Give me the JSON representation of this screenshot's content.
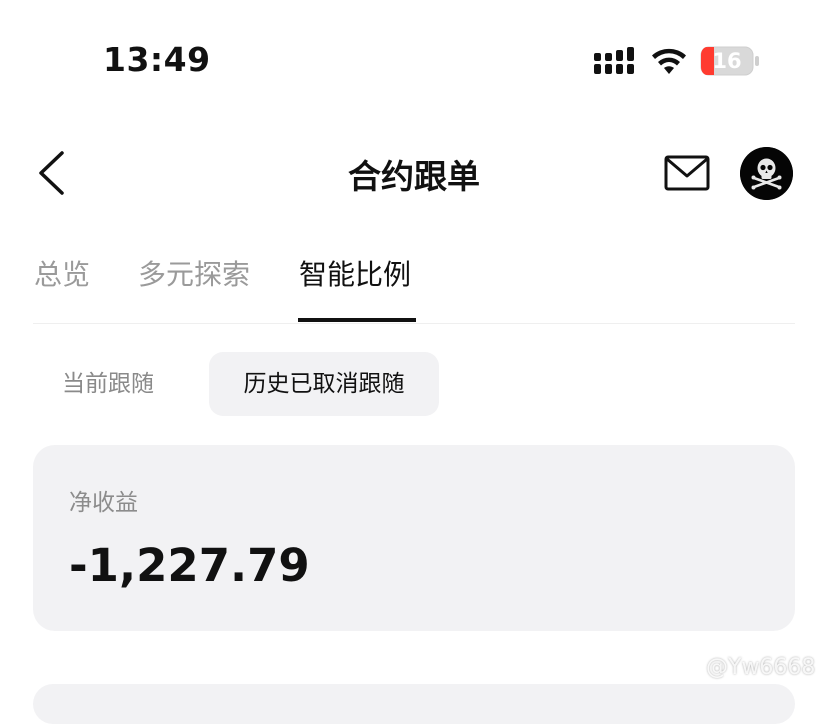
{
  "status_bar": {
    "time": "13:49",
    "battery_level": "16"
  },
  "nav": {
    "title": "合约跟单"
  },
  "tabs": [
    {
      "label": "总览",
      "active": false
    },
    {
      "label": "多元探索",
      "active": false
    },
    {
      "label": "智能比例",
      "active": true
    }
  ],
  "sub_tabs": [
    {
      "label": "当前跟随",
      "active": false
    },
    {
      "label": "历史已取消跟随",
      "active": true
    }
  ],
  "summary": {
    "label": "净收益",
    "value": "-1,227.79"
  },
  "watermark": {
    "text": "@Yw6668"
  },
  "colors": {
    "card_bg": "#f2f2f4",
    "muted_text": "#9a9a9a",
    "battery_low": "#ff3b30"
  }
}
